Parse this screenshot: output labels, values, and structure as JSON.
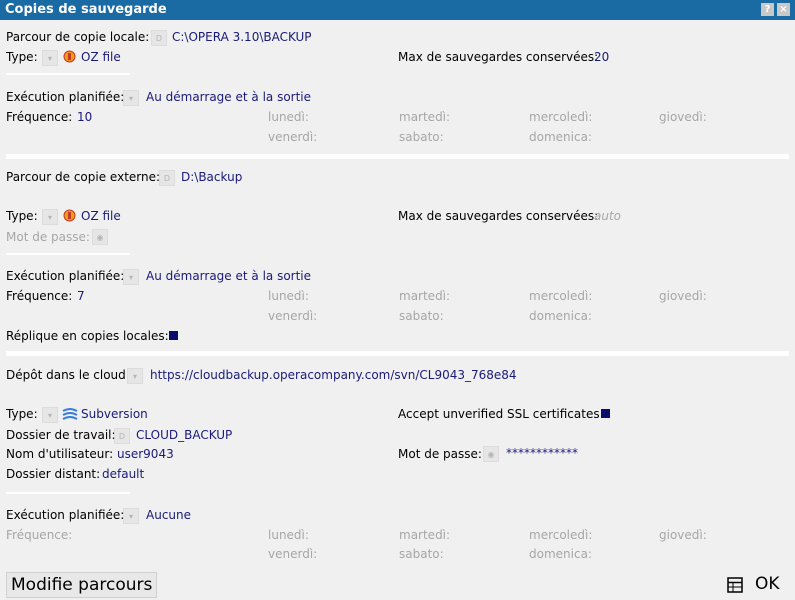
{
  "window": {
    "title": "Copies de sauvegarde",
    "help_label": "?",
    "close_label": "×"
  },
  "days": {
    "mon": "lunedì:",
    "tue": "martedì:",
    "wed": "mercoledì:",
    "thu": "giovedì:",
    "fri": "venerdì:",
    "sat": "sabato:",
    "sun": "domenica:"
  },
  "local": {
    "path_label": "Parcour de copie locale:",
    "path_value": "C:\\OPERA 3.10\\BACKUP",
    "type_label": "Type:",
    "type_value": "OZ file",
    "max_label": "Max de sauvegardes conservées:",
    "max_value": "20",
    "sched_label": "Exécution planifiée:",
    "sched_value": "Au démarrage et à la sortie",
    "freq_label": "Fréquence:",
    "freq_value": "10"
  },
  "external": {
    "path_label": "Parcour de copie externe:",
    "path_value": "D:\\Backup",
    "type_label": "Type:",
    "type_value": "OZ file",
    "max_label": "Max de sauvegardes conservées:",
    "max_value": "auto",
    "pwd_label": "Mot de passe:",
    "sched_label": "Exécution planifiée:",
    "sched_value": "Au démarrage et à la sortie",
    "freq_label": "Fréquence:",
    "freq_value": "7",
    "replica_label": "Réplique en copies locales:"
  },
  "cloud": {
    "repo_label": "Dépôt dans le cloud:",
    "repo_value": "https://cloudbackup.operacompany.com/svn/CL9043_768e84",
    "type_label": "Type:",
    "type_value": "Subversion",
    "ssl_label": "Accept unverified SSL certificates:",
    "workdir_label": "Dossier de travail:",
    "workdir_value": "CLOUD_BACKUP",
    "user_label": "Nom d'utilisateur:",
    "user_value": "user9043",
    "pwd_label": "Mot de passe:",
    "pwd_value": "************",
    "remote_label": "Dossier distant:",
    "remote_value": "default",
    "sched_label": "Exécution planifiée:",
    "sched_value": "Aucune",
    "freq_label": "Fréquence:"
  },
  "footer": {
    "modify_label": "Modifie parcours",
    "ok_label": "OK"
  },
  "colors": {
    "titlebar": "#1a6aa3",
    "value_text": "#1a1a7a",
    "dim_text": "#a6a6a6",
    "checkbox": "#0b0b6e"
  }
}
